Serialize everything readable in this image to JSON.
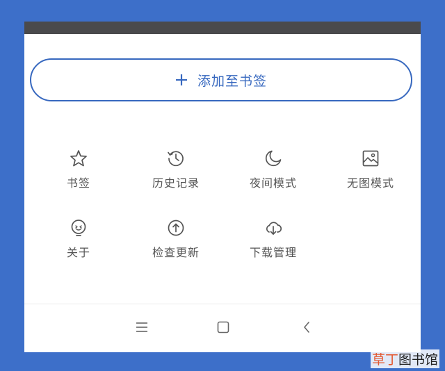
{
  "add_bookmark": {
    "label": "添加至书签",
    "icon": "plus-icon",
    "accent": "#3768bf"
  },
  "grid": [
    {
      "label": "书签",
      "icon": "star-icon"
    },
    {
      "label": "历史记录",
      "icon": "history-clock-icon"
    },
    {
      "label": "夜间模式",
      "icon": "moon-icon"
    },
    {
      "label": "无图模式",
      "icon": "image-icon"
    },
    {
      "label": "关于",
      "icon": "smiley-icon"
    },
    {
      "label": "检查更新",
      "icon": "upload-icon"
    },
    {
      "label": "下载管理",
      "icon": "cloud-download-icon"
    }
  ],
  "navbar": {
    "menu_icon": "menu-icon",
    "home_icon": "square-icon",
    "back_icon": "back-icon"
  },
  "watermark": {
    "part1": "草丁",
    "part2": "图书馆"
  },
  "colors": {
    "background": "#3d6fc9",
    "status_bar": "#4a4a4c",
    "icon": "#555555"
  }
}
